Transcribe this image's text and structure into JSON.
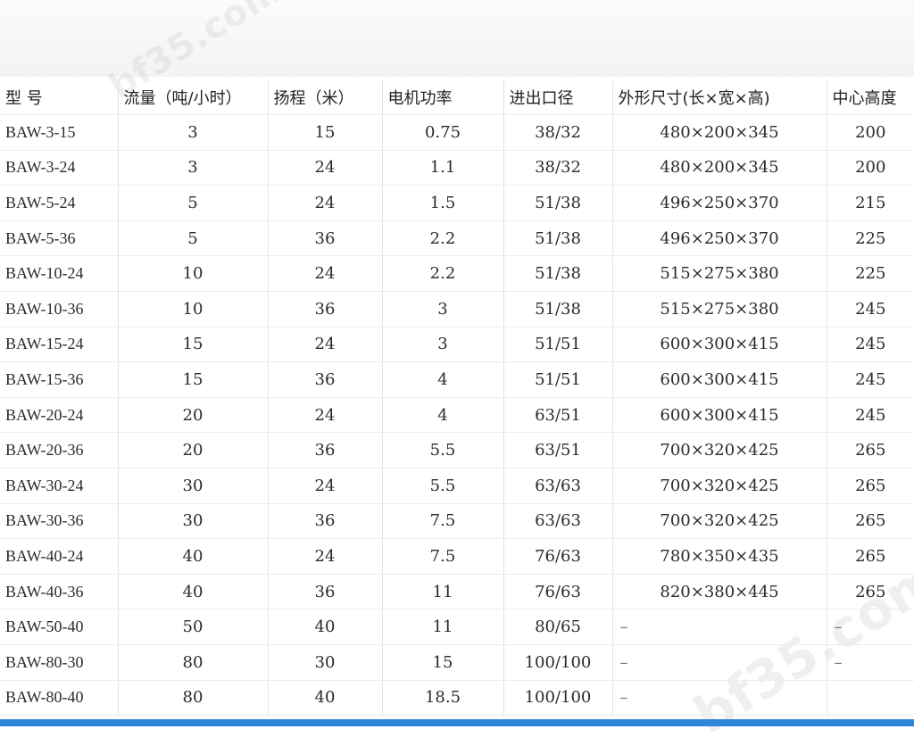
{
  "watermark": "bf35.com",
  "table": {
    "headers": [
      "型 号",
      "流量（吨/小时）",
      "扬程（米）",
      "电机功率",
      "进出口径",
      "外形尺寸(长×宽×高)",
      "中心高度"
    ],
    "rows": [
      [
        "BAW-3-15",
        "3",
        "15",
        "0.75",
        "38/32",
        "480×200×345",
        "200"
      ],
      [
        "BAW-3-24",
        "3",
        "24",
        "1.1",
        "38/32",
        "480×200×345",
        "200"
      ],
      [
        "BAW-5-24",
        "5",
        "24",
        "1.5",
        "51/38",
        "496×250×370",
        "215"
      ],
      [
        "BAW-5-36",
        "5",
        "36",
        "2.2",
        "51/38",
        "496×250×370",
        "225"
      ],
      [
        "BAW-10-24",
        "10",
        "24",
        "2.2",
        "51/38",
        "515×275×380",
        "225"
      ],
      [
        "BAW-10-36",
        "10",
        "36",
        "3",
        "51/38",
        "515×275×380",
        "245"
      ],
      [
        "BAW-15-24",
        "15",
        "24",
        "3",
        "51/51",
        "600×300×415",
        "245"
      ],
      [
        "BAW-15-36",
        "15",
        "36",
        "4",
        "51/51",
        "600×300×415",
        "245"
      ],
      [
        "BAW-20-24",
        "20",
        "24",
        "4",
        "63/51",
        "600×300×415",
        "245"
      ],
      [
        "BAW-20-36",
        "20",
        "36",
        "5.5",
        "63/51",
        "700×320×425",
        "265"
      ],
      [
        "BAW-30-24",
        "30",
        "24",
        "5.5",
        "63/63",
        "700×320×425",
        "265"
      ],
      [
        "BAW-30-36",
        "30",
        "36",
        "7.5",
        "63/63",
        "700×320×425",
        "265"
      ],
      [
        "BAW-40-24",
        "40",
        "24",
        "7.5",
        "76/63",
        "780×350×435",
        "265"
      ],
      [
        "BAW-40-36",
        "40",
        "36",
        "11",
        "76/63",
        "820×380×445",
        "265"
      ],
      [
        "BAW-50-40",
        "50",
        "40",
        "11",
        "80/65",
        "–",
        "–"
      ],
      [
        "BAW-80-30",
        "80",
        "30",
        "15",
        "100/100",
        "–",
        "–"
      ],
      [
        "BAW-80-40",
        "80",
        "40",
        "18.5",
        "100/100",
        "–",
        ""
      ]
    ]
  }
}
